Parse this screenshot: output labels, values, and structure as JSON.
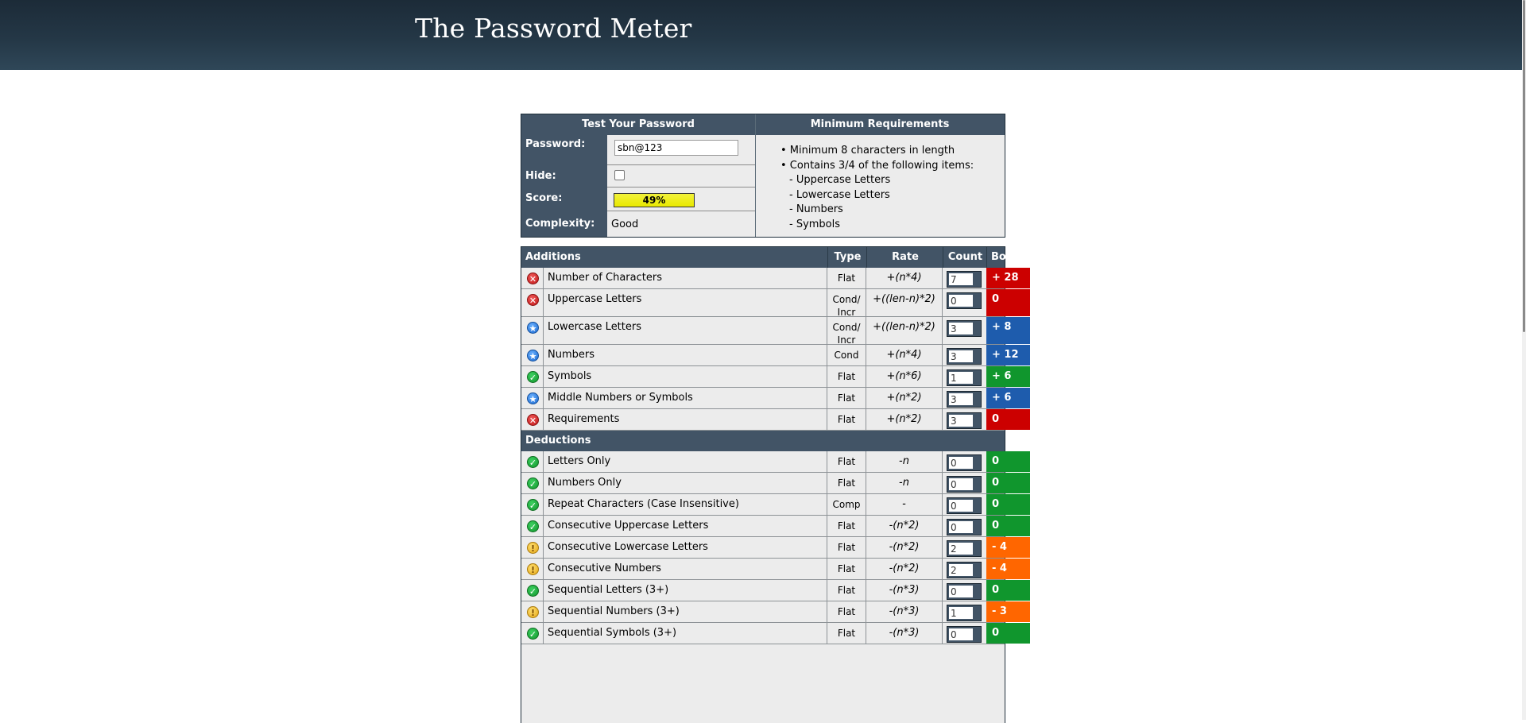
{
  "app_title": "The Password Meter",
  "test": {
    "header_left": "Test Your Password",
    "header_right": "Minimum Requirements",
    "password_label": "Password:",
    "password_value": "sbn@123",
    "hide_label": "Hide:",
    "hide_checked": false,
    "score_label": "Score:",
    "score_value": "49%",
    "score_percent": 49,
    "complexity_label": "Complexity:",
    "complexity_value": "Good"
  },
  "requirements": {
    "items": [
      "• Minimum 8 characters in length",
      "• Contains 3/4 of the following items:"
    ],
    "subitems": [
      "- Uppercase Letters",
      "- Lowercase Letters",
      "- Numbers",
      "- Symbols"
    ]
  },
  "table_headers": {
    "additions": "Additions",
    "type": "Type",
    "rate": "Rate",
    "count": "Count",
    "bonus": "Bonus",
    "deductions": "Deductions"
  },
  "colors": {
    "fail": "#cc0000",
    "exceed": "#1e5cad",
    "pass": "#10962d",
    "warn": "#ff6600"
  },
  "additions": [
    {
      "icon": "fail-icon",
      "name": "Number of Characters",
      "type": "Flat",
      "rate": "+(n*4)",
      "count": "7",
      "bonus": "+ 28",
      "status": "fail"
    },
    {
      "icon": "fail-icon",
      "name": "Uppercase Letters",
      "type": "Cond/\nIncr",
      "rate": "+((len-n)*2)",
      "count": "0",
      "bonus": "0",
      "status": "fail"
    },
    {
      "icon": "exceed-icon",
      "name": "Lowercase Letters",
      "type": "Cond/\nIncr",
      "rate": "+((len-n)*2)",
      "count": "3",
      "bonus": "+ 8",
      "status": "exceed"
    },
    {
      "icon": "exceed-icon",
      "name": "Numbers",
      "type": "Cond",
      "rate": "+(n*4)",
      "count": "3",
      "bonus": "+ 12",
      "status": "exceed"
    },
    {
      "icon": "pass-icon",
      "name": "Symbols",
      "type": "Flat",
      "rate": "+(n*6)",
      "count": "1",
      "bonus": "+ 6",
      "status": "pass"
    },
    {
      "icon": "exceed-icon",
      "name": "Middle Numbers or Symbols",
      "type": "Flat",
      "rate": "+(n*2)",
      "count": "3",
      "bonus": "+ 6",
      "status": "exceed"
    },
    {
      "icon": "fail-icon",
      "name": "Requirements",
      "type": "Flat",
      "rate": "+(n*2)",
      "count": "3",
      "bonus": "0",
      "status": "fail"
    }
  ],
  "deductions": [
    {
      "icon": "pass-icon",
      "name": "Letters Only",
      "type": "Flat",
      "rate": "-n",
      "count": "0",
      "bonus": "0",
      "status": "pass"
    },
    {
      "icon": "pass-icon",
      "name": "Numbers Only",
      "type": "Flat",
      "rate": "-n",
      "count": "0",
      "bonus": "0",
      "status": "pass"
    },
    {
      "icon": "pass-icon",
      "name": "Repeat Characters (Case Insensitive)",
      "type": "Comp",
      "rate": "-",
      "count": "0",
      "bonus": "0",
      "status": "pass"
    },
    {
      "icon": "pass-icon",
      "name": "Consecutive Uppercase Letters",
      "type": "Flat",
      "rate": "-(n*2)",
      "count": "0",
      "bonus": "0",
      "status": "pass"
    },
    {
      "icon": "warn-icon",
      "name": "Consecutive Lowercase Letters",
      "type": "Flat",
      "rate": "-(n*2)",
      "count": "2",
      "bonus": "- 4",
      "status": "warn"
    },
    {
      "icon": "warn-icon",
      "name": "Consecutive Numbers",
      "type": "Flat",
      "rate": "-(n*2)",
      "count": "2",
      "bonus": "- 4",
      "status": "warn"
    },
    {
      "icon": "pass-icon",
      "name": "Sequential Letters (3+)",
      "type": "Flat",
      "rate": "-(n*3)",
      "count": "0",
      "bonus": "0",
      "status": "pass"
    },
    {
      "icon": "warn-icon",
      "name": "Sequential Numbers (3+)",
      "type": "Flat",
      "rate": "-(n*3)",
      "count": "1",
      "bonus": "- 3",
      "status": "warn"
    },
    {
      "icon": "pass-icon",
      "name": "Sequential Symbols (3+)",
      "type": "Flat",
      "rate": "-(n*3)",
      "count": "0",
      "bonus": "0",
      "status": "pass"
    }
  ]
}
